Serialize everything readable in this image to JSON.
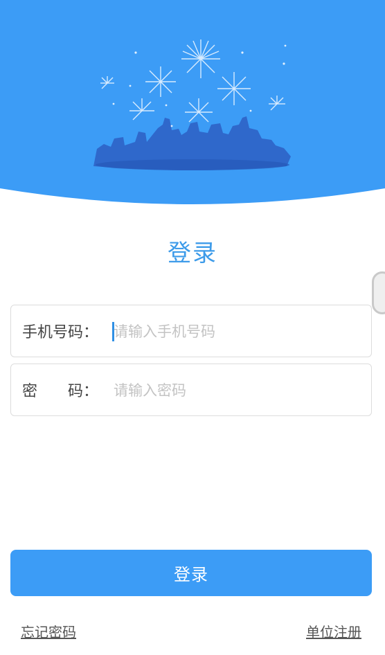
{
  "header": {
    "title": "登录",
    "illustration": "fireworks-city-skyline",
    "background_color": "#3c9cf6"
  },
  "form": {
    "phone": {
      "label": "手机号码：",
      "placeholder": "请输入手机号码",
      "value": ""
    },
    "password": {
      "label": "密　　码：",
      "placeholder": "请输入密码",
      "value": ""
    }
  },
  "actions": {
    "login_label": "登录",
    "forgot_label": "忘记密码",
    "register_label": "单位注册"
  },
  "colors": {
    "accent": "#3c9cf6",
    "title": "#3d9be9",
    "border": "#dcdcdc"
  }
}
